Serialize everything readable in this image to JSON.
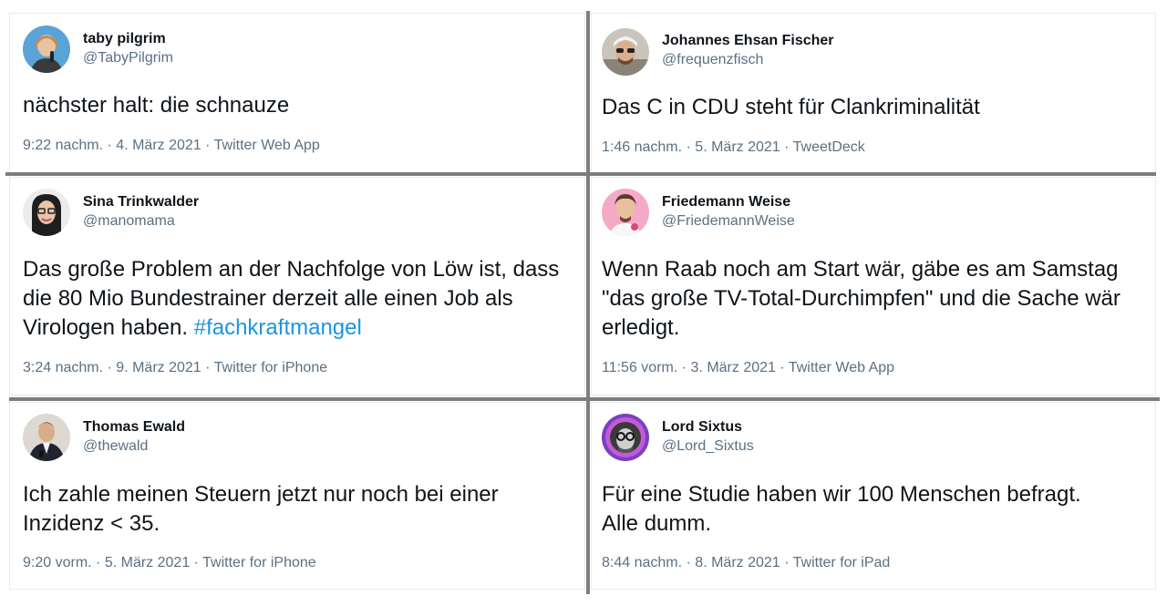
{
  "tweets": [
    {
      "name": "taby pilgrim",
      "handle": "@TabyPilgrim",
      "text": "nächster halt: die schnauze",
      "time": "9:22 nachm.",
      "date": "4. März 2021",
      "source": "Twitter Web App",
      "avatar_icon": "profile-photo-woman-microphone-icon",
      "avatar_bg": "#5aa3d6"
    },
    {
      "name": "Johannes Ehsan Fischer",
      "handle": "@frequenzfisch",
      "text": "Das C in CDU steht für Clankriminalität",
      "time": "1:46 nachm.",
      "date": "5. März 2021",
      "source": "TweetDeck",
      "avatar_icon": "profile-photo-man-sunglasses-icon",
      "avatar_bg": "#b9b6ae"
    },
    {
      "name": "Sina Trinkwalder",
      "handle": "@manomama",
      "text": "Das große Problem an der Nachfolge von Löw ist, dass die 80 Mio Bundestrainer derzeit alle einen Job als Virologen haben. ",
      "hashtag": "#fachkraftmangel",
      "time": "3:24 nachm.",
      "date": "9. März 2021",
      "source": "Twitter for iPhone",
      "avatar_icon": "profile-photo-woman-glasses-icon",
      "avatar_bg": "#e8e8e8"
    },
    {
      "name": "Friedemann Weise",
      "handle": "@FriedemannWeise",
      "text": "Wenn Raab noch am Start wär, gäbe es am Samstag \"das große TV-Total-Durchimpfen\" und die Sache wär erledigt.",
      "time": "11:56 vorm.",
      "date": "3. März 2021",
      "source": "Twitter Web App",
      "avatar_icon": "profile-photo-man-pink-background-icon",
      "avatar_bg": "#f3a6c4"
    },
    {
      "name": "Thomas Ewald",
      "handle": "@thewald",
      "text": "Ich zahle meinen Steuern jetzt nur noch bei einer Inzidenz < 35.",
      "time": "9:20 vorm.",
      "date": "5. März 2021",
      "source": "Twitter for iPhone",
      "avatar_icon": "profile-photo-man-suit-icon",
      "avatar_bg": "#d9d4cc"
    },
    {
      "name": "Lord Sixtus",
      "handle": "@Lord_Sixtus",
      "text": "Für eine Studie haben wir 100 Menschen befragt. Alle dumm.",
      "time": "8:44 nachm.",
      "date": "8. März 2021",
      "source": "Twitter for iPad",
      "avatar_icon": "profile-photo-man-glasses-purple-icon",
      "avatar_bg": "#8e4cc9"
    }
  ],
  "meta_separator": "·",
  "colors": {
    "text": "#0f1419",
    "secondary": "#5b7083",
    "hashtag": "#1b95e0",
    "divider": "#7d7d7d"
  }
}
